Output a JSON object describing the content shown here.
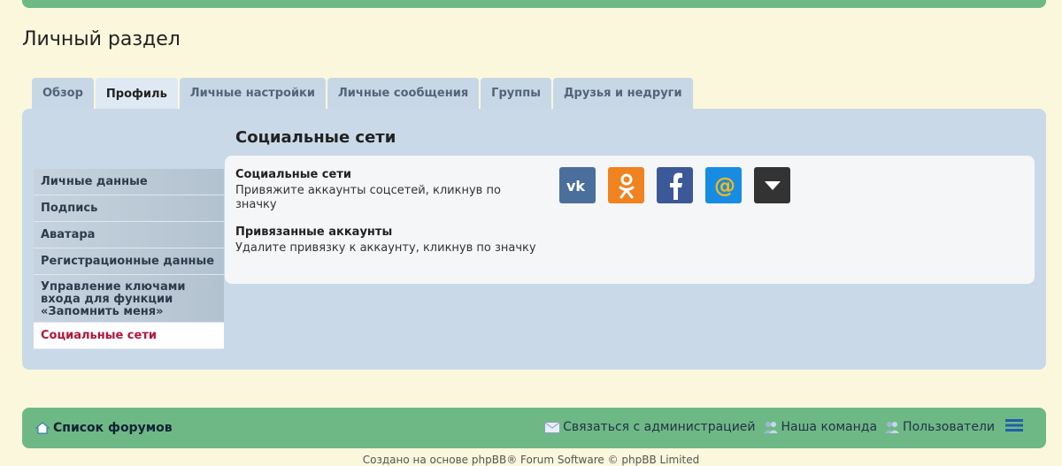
{
  "page": {
    "title": "Личный раздел"
  },
  "tabs": [
    {
      "label": "Обзор"
    },
    {
      "label": "Профиль"
    },
    {
      "label": "Личные настройки"
    },
    {
      "label": "Личные сообщения"
    },
    {
      "label": "Группы"
    },
    {
      "label": "Друзья и недруги"
    }
  ],
  "sidebar": {
    "items": [
      {
        "label": "Личные данные"
      },
      {
        "label": "Подпись"
      },
      {
        "label": "Аватара"
      },
      {
        "label": "Регистрационные данные"
      },
      {
        "label": "Управление ключами входа для функции «Запомнить меня»"
      },
      {
        "label": "Социальные сети"
      }
    ]
  },
  "main": {
    "section_title": "Социальные сети",
    "rows": [
      {
        "title": "Социальные сети",
        "desc": "Привяжите аккаунты соцсетей, кликнув по значку"
      },
      {
        "title": "Привязанные аккаунты",
        "desc": "Удалите привязку к аккаунту, кликнув по значку"
      }
    ],
    "social_icons": [
      {
        "name": "vk-icon",
        "color": "#4b6f9c"
      },
      {
        "name": "odnoklassniki-icon",
        "color": "#f08220"
      },
      {
        "name": "facebook-icon",
        "color": "#3b5998"
      },
      {
        "name": "mailru-icon",
        "color": "#168de2"
      },
      {
        "name": "more-icon",
        "color": "#333333"
      }
    ]
  },
  "footer": {
    "home_label": "Список форумов",
    "links": [
      {
        "label": "Связаться с администрацией"
      },
      {
        "label": "Наша команда"
      },
      {
        "label": "Пользователи"
      }
    ],
    "copyright": "Создано на основе phpBB® Forum Software © phpBB Limited"
  }
}
